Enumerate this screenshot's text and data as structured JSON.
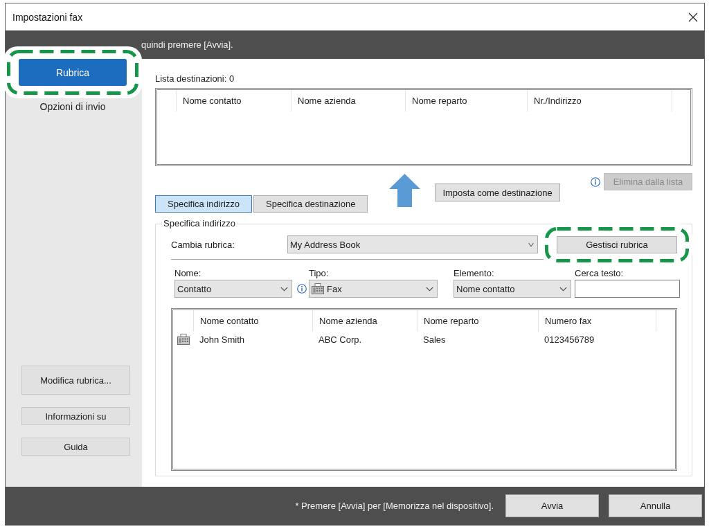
{
  "window": {
    "title": "Impostazioni fax"
  },
  "instruction_bar": {
    "text": "quindi premere [Avvia]."
  },
  "sidebar": {
    "items": [
      {
        "label": "Rubrica",
        "selected": true,
        "highlighted": true
      },
      {
        "label": "Opzioni di invio",
        "selected": false,
        "highlighted": false
      }
    ],
    "buttons": [
      "Modifica rubrica...",
      "Informazioni su",
      "Guida"
    ]
  },
  "destination_list": {
    "label": "Lista destinazioni: 0",
    "columns": [
      "Nome contatto",
      "Nome azienda",
      "Nome reparto",
      "Nr./Indirizzo"
    ]
  },
  "set_destination_button": {
    "label": "Imposta come destinazione"
  },
  "remove_button": {
    "label": "Elimina dalla lista",
    "disabled": true
  },
  "tabs": [
    {
      "label": "Specifica indirizzo",
      "selected": true
    },
    {
      "label": "Specifica destinazione",
      "selected": false
    }
  ],
  "address_panel": {
    "legend": "Specifica indirizzo",
    "address_book": {
      "label": "Cambia rubrica:",
      "value": "My Address Book"
    },
    "manage_button": {
      "label": "Gestisci rubrica",
      "highlighted": true
    },
    "filters": [
      {
        "kind": "select",
        "label": "Nome:",
        "value": "Contatto",
        "info": true
      },
      {
        "kind": "iconselect",
        "label": "Tipo:",
        "value": "Fax",
        "info": false
      },
      {
        "kind": "select",
        "label": "Elemento:",
        "value": "Nome contatto",
        "info": false
      },
      {
        "kind": "text",
        "label": "Cerca testo:",
        "info": false
      }
    ],
    "contacts": {
      "columns": [
        "Nome contatto",
        "Nome azienda",
        "Nome reparto",
        "Numero fax"
      ],
      "rows": [
        {
          "cells": [
            "John Smith",
            "ABC Corp.",
            "Sales",
            "0123456789"
          ]
        }
      ]
    }
  },
  "footer": {
    "note": "* Premere [Avvia] per [Memorizza nel dispositivo].",
    "buttons": [
      "Avvia",
      "Annulla"
    ]
  }
}
